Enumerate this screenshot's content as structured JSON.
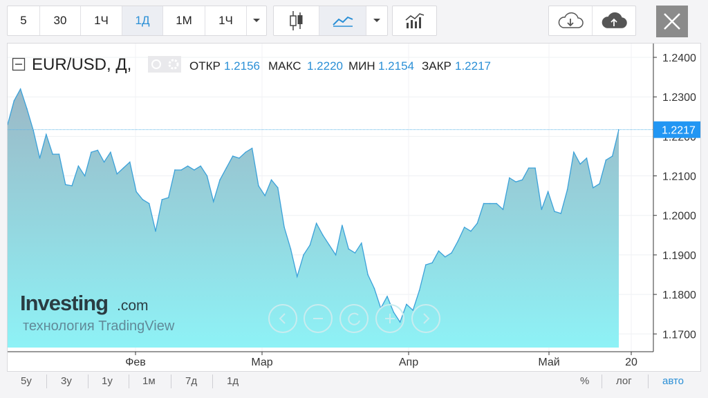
{
  "toolbar": {
    "intervals": [
      "5",
      "30",
      "1Ч",
      "1Д",
      "1М",
      "1Ч"
    ],
    "active_interval_index": 3,
    "chart_types": [
      "candles-icon",
      "area-line-icon"
    ],
    "active_chart_type_index": 1,
    "icons": [
      "chevron-down-icon",
      "indicators-icon",
      "cloud-download-icon",
      "cloud-upload-icon",
      "close-icon"
    ]
  },
  "legend": {
    "symbol": "EUR/USD, Д,",
    "open_label": "ОТКР",
    "open_value": "1.2156",
    "high_label": "МАКС",
    "high_value": "1.2220",
    "low_label": "МИН",
    "low_value": "1.2154",
    "close_label": "ЗАКР",
    "close_value": "1.2217"
  },
  "watermark": {
    "brand": "Investing",
    "brand_suffix": ".com",
    "tagline": "технология TradingView"
  },
  "price_label": "1.2217",
  "bottom": {
    "ranges": [
      "5у",
      "3у",
      "1у",
      "1м",
      "7д",
      "1д"
    ],
    "percent_label": "%",
    "log_label": "лог",
    "auto_label": "авто"
  },
  "colors": {
    "accent": "#2a8fd6",
    "line": "#3ba1d9",
    "fill_top": "#9bb8c6",
    "fill_bottom": "#8ef2f6",
    "price_tag": "#2196f3"
  },
  "chart_data": {
    "type": "area",
    "title": "EUR/USD, Д,",
    "xlabel": "",
    "ylabel": "",
    "ylim": [
      1.1655,
      1.2435
    ],
    "yticks": [
      "1.2400",
      "1.2300",
      "1.2200",
      "1.2100",
      "1.2000",
      "1.1900",
      "1.1800",
      "1.1700"
    ],
    "xticks": [
      "Фев",
      "Мар",
      "Апр",
      "Май",
      "20"
    ],
    "grid": true,
    "series": [
      {
        "values": [
          1.223,
          1.229,
          1.232,
          1.227,
          1.2215,
          1.2145,
          1.2205,
          1.2155,
          1.2155,
          1.2078,
          1.2075,
          1.2125,
          1.21,
          1.216,
          1.2165,
          1.2135,
          1.216,
          1.2105,
          1.212,
          1.2135,
          1.206,
          1.204,
          1.203,
          1.196,
          1.204,
          1.2045,
          1.2115,
          1.2115,
          1.2125,
          1.2115,
          1.2125,
          1.21,
          1.2035,
          1.209,
          1.212,
          1.215,
          1.2145,
          1.216,
          1.217,
          1.2075,
          1.205,
          1.209,
          1.207,
          1.197,
          1.1915,
          1.1845,
          1.19,
          1.1925,
          1.198,
          1.195,
          1.1925,
          1.19,
          1.1975,
          1.1915,
          1.1905,
          1.193,
          1.185,
          1.1815,
          1.1765,
          1.1795,
          1.1755,
          1.173,
          1.1775,
          1.176,
          1.181,
          1.1875,
          1.188,
          1.191,
          1.1895,
          1.1905,
          1.1935,
          1.197,
          1.196,
          1.198,
          1.203,
          1.203,
          1.203,
          1.2015,
          1.2095,
          1.2085,
          1.209,
          1.212,
          1.212,
          1.2015,
          1.206,
          1.201,
          1.2005,
          1.2065,
          1.216,
          1.213,
          1.2145,
          1.207,
          1.208,
          1.214,
          1.215,
          1.2217
        ]
      }
    ]
  }
}
